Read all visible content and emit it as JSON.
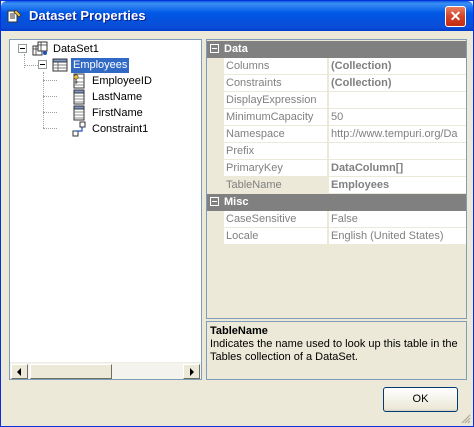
{
  "window": {
    "title": "Dataset Properties",
    "close_glyph": "✕"
  },
  "tree": {
    "root": {
      "label": "DataSet1",
      "icon": "dataset-icon"
    },
    "table": {
      "label": "Employees",
      "icon": "table-icon"
    },
    "columns": [
      {
        "label": "EmployeeID",
        "icon": "key-column-icon"
      },
      {
        "label": "LastName",
        "icon": "column-icon"
      },
      {
        "label": "FirstName",
        "icon": "column-icon"
      },
      {
        "label": "Constraint1",
        "icon": "constraint-icon"
      }
    ]
  },
  "grid": {
    "categories": [
      {
        "label": "Data",
        "rows": [
          {
            "name": "Columns",
            "value": "(Collection)",
            "bold": true
          },
          {
            "name": "Constraints",
            "value": "(Collection)",
            "bold": true
          },
          {
            "name": "DisplayExpression",
            "value": "",
            "bold": false
          },
          {
            "name": "MinimumCapacity",
            "value": "50",
            "bold": false
          },
          {
            "name": "Namespace",
            "value": "http://www.tempuri.org/Da",
            "bold": false
          },
          {
            "name": "Prefix",
            "value": "",
            "bold": false
          },
          {
            "name": "PrimaryKey",
            "value": "DataColumn[]",
            "bold": true
          },
          {
            "name": "TableName",
            "value": "Employees",
            "bold": true,
            "selected": true
          }
        ]
      },
      {
        "label": "Misc",
        "rows": [
          {
            "name": "CaseSensitive",
            "value": "False",
            "bold": false
          },
          {
            "name": "Locale",
            "value": "English (United States)",
            "bold": false
          }
        ]
      }
    ]
  },
  "description": {
    "title": "TableName",
    "text": "Indicates the name used to look up this table in the Tables collection of a DataSet."
  },
  "buttons": {
    "ok": "OK"
  },
  "colors": {
    "titlebar": "#0058e6",
    "selection": "#316ac5",
    "category": "#808080"
  }
}
